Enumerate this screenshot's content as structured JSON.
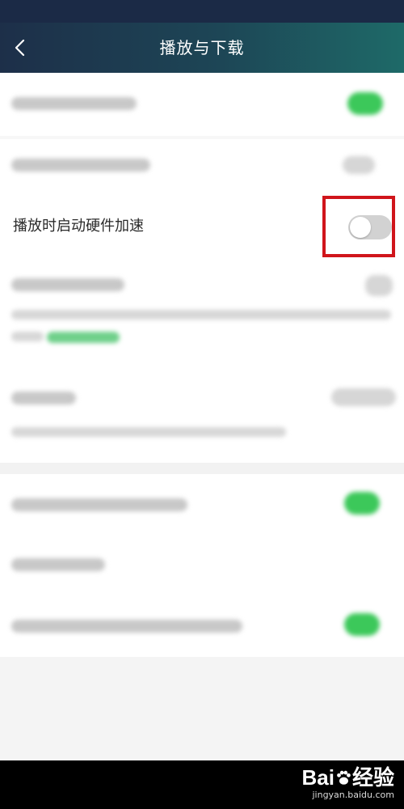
{
  "header": {
    "title": "播放与下载",
    "back_icon": "chevron-left-icon"
  },
  "settings": {
    "hardware_acceleration": {
      "label": "播放时启动硬件加速",
      "enabled": false
    }
  },
  "colors": {
    "header_start": "#1d2f49",
    "header_end": "#1e6a68",
    "toggle_on": "#3cc85a",
    "toggle_off": "#d2d2d2",
    "highlight": "#d0151b"
  },
  "watermark": {
    "brand_prefix": "Bai",
    "brand_suffix": "经验",
    "url": "jingyan.baidu.com"
  }
}
